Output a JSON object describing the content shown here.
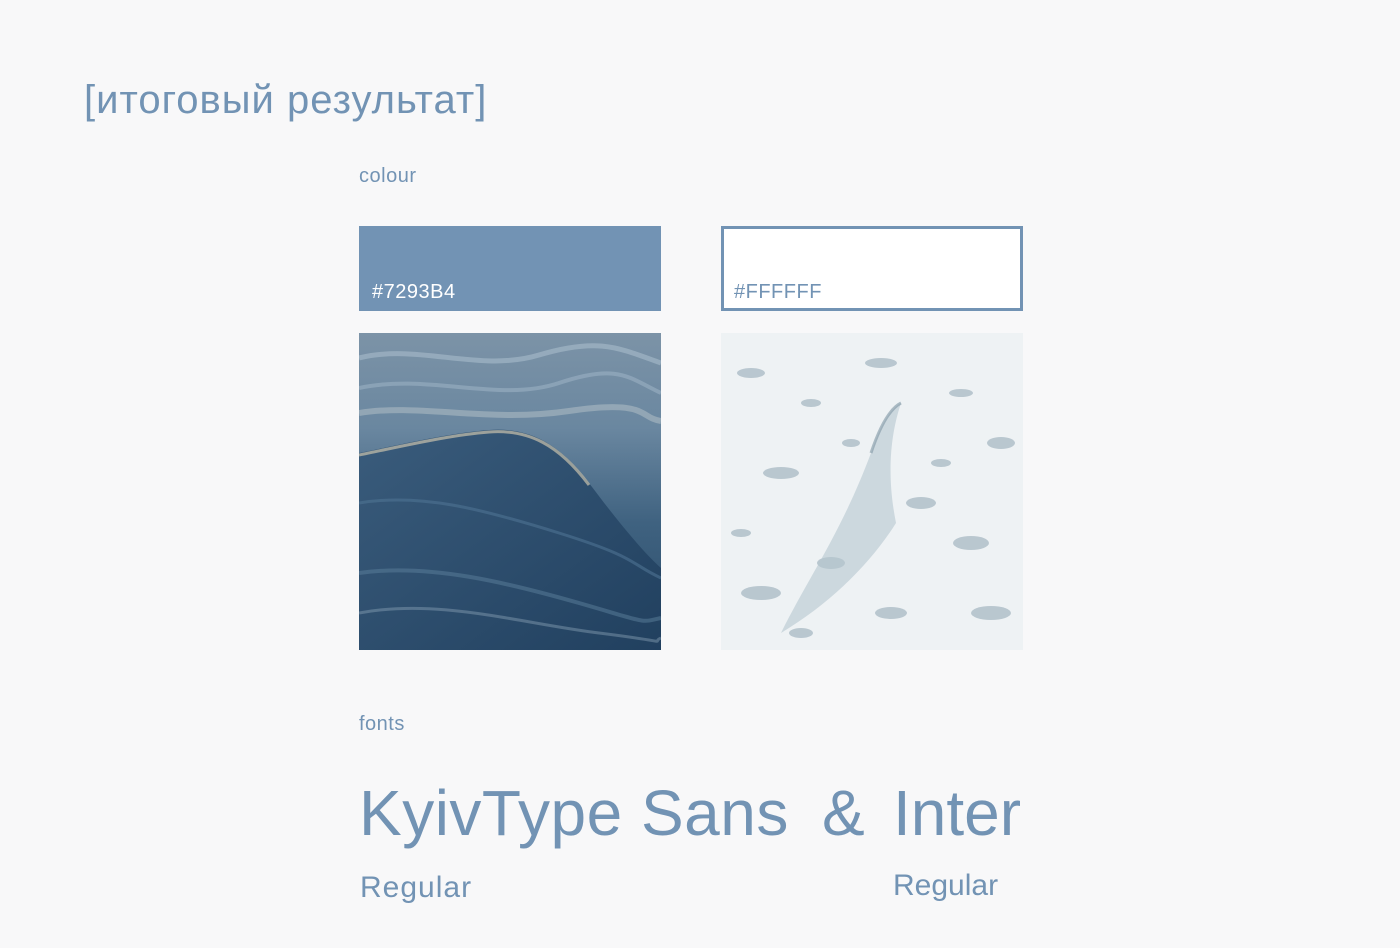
{
  "page": {
    "title": "[итоговый результат]"
  },
  "colour": {
    "label": "colour",
    "swatches": [
      {
        "code": "#7293B4",
        "hex": "#7293b4"
      },
      {
        "code": "#FFFFFF",
        "hex": "#ffffff"
      }
    ],
    "images": [
      {
        "icon": "calm-water-wave-image"
      },
      {
        "icon": "sea-foam-image"
      }
    ]
  },
  "fonts": {
    "label": "fonts",
    "primary": {
      "name": "KyivType Sans",
      "weight": "Regular"
    },
    "separator": "&",
    "secondary": {
      "name": "Inter",
      "weight": "Regular"
    }
  },
  "colors": {
    "accent": "#7293b4",
    "background": "#f8f8f9"
  }
}
